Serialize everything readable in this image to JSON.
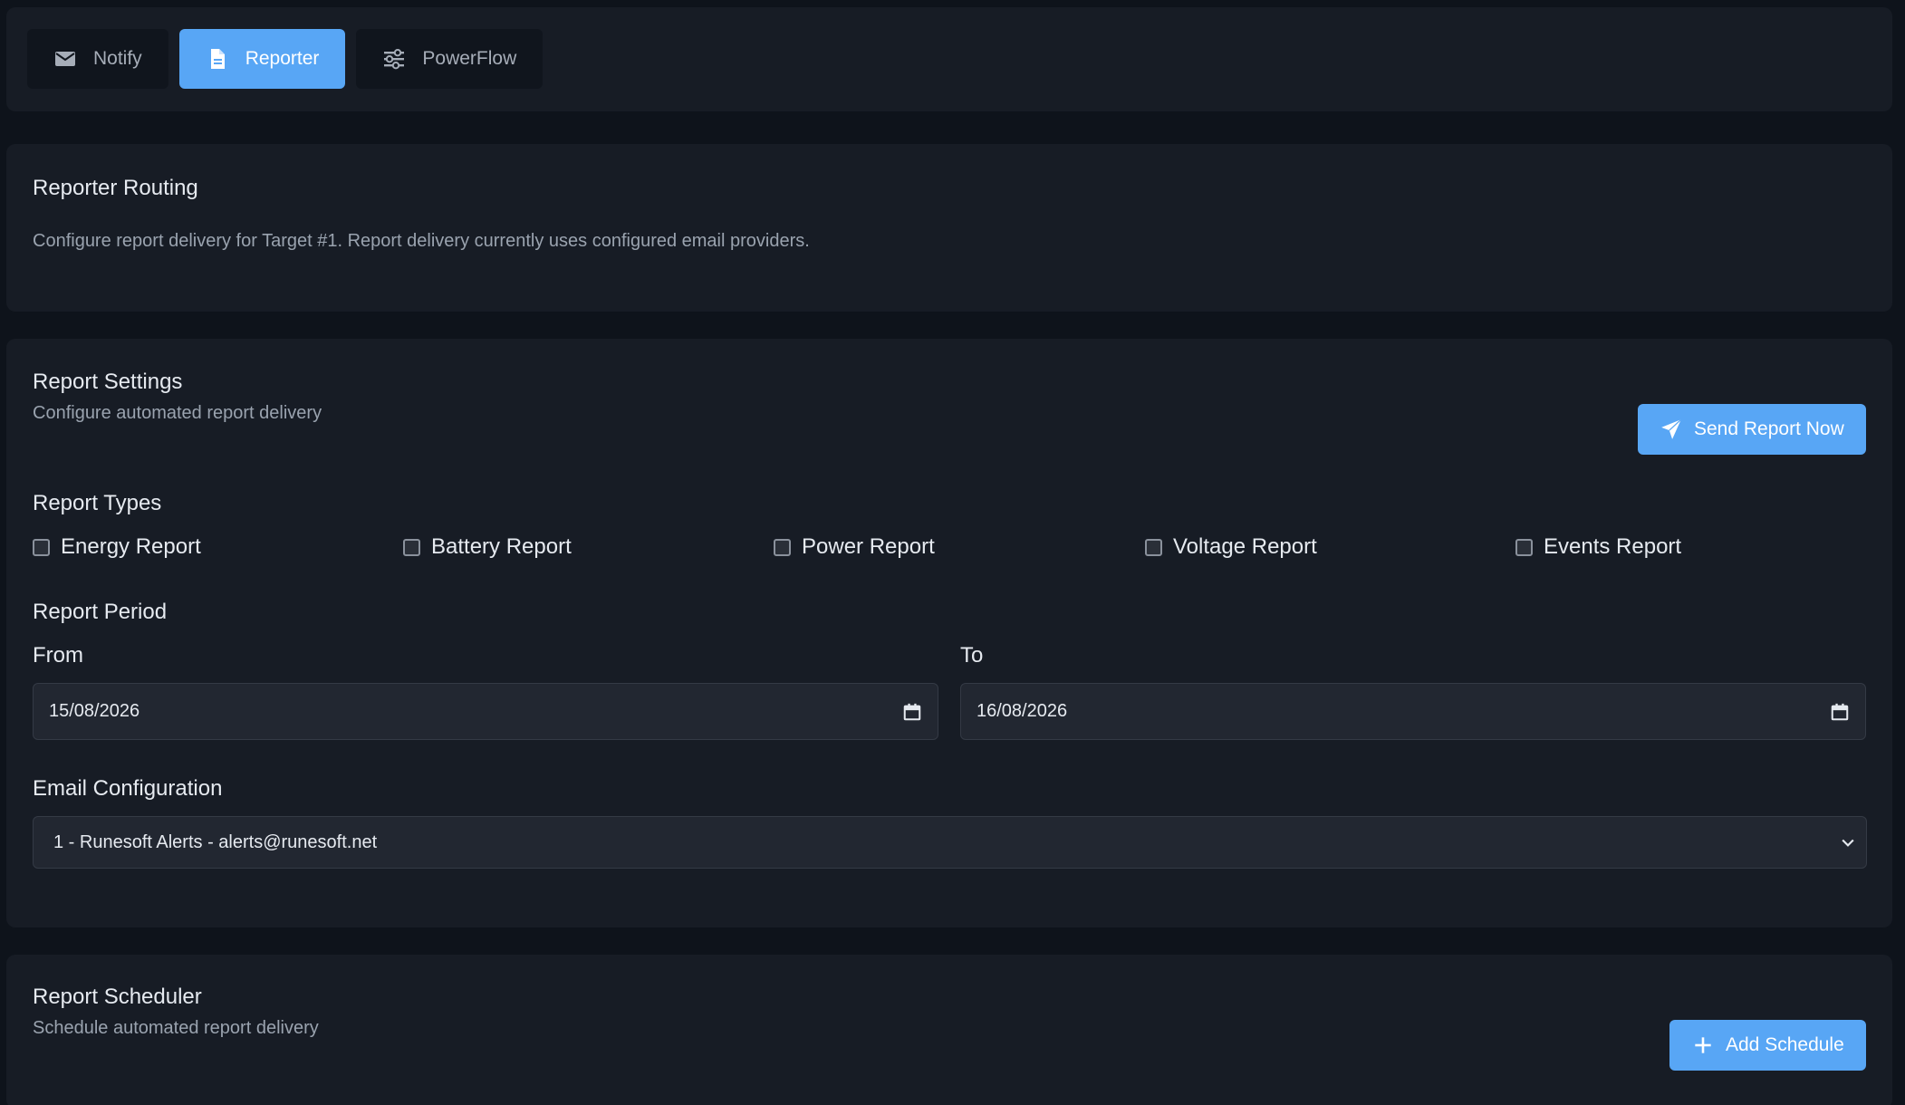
{
  "tabs": [
    {
      "label": "Notify",
      "icon": "envelope-icon",
      "active": false
    },
    {
      "label": "Reporter",
      "icon": "document-icon",
      "active": true
    },
    {
      "label": "PowerFlow",
      "icon": "sliders-icon",
      "active": false
    }
  ],
  "routing": {
    "title": "Reporter Routing",
    "description": "Configure report delivery for Target #1. Report delivery currently uses configured email providers."
  },
  "settings": {
    "title": "Report Settings",
    "subtitle": "Configure automated report delivery",
    "send_button": "Send Report Now",
    "report_types_label": "Report Types",
    "report_types": [
      {
        "label": "Energy Report",
        "checked": false
      },
      {
        "label": "Battery Report",
        "checked": false
      },
      {
        "label": "Power Report",
        "checked": false
      },
      {
        "label": "Voltage Report",
        "checked": false
      },
      {
        "label": "Events Report",
        "checked": false
      }
    ],
    "period_label": "Report Period",
    "from_label": "From",
    "from_value": "15/08/2026",
    "to_label": "To",
    "to_value": "16/08/2026",
    "email_label": "Email Configuration",
    "email_selected": "1 - Runesoft Alerts - alerts@runesoft.net"
  },
  "scheduler": {
    "title": "Report Scheduler",
    "subtitle": "Schedule automated report delivery",
    "add_button": "Add Schedule"
  },
  "colors": {
    "accent": "#58a6f5",
    "background": "#0e131b",
    "card": "#171c25",
    "input": "#222731"
  }
}
